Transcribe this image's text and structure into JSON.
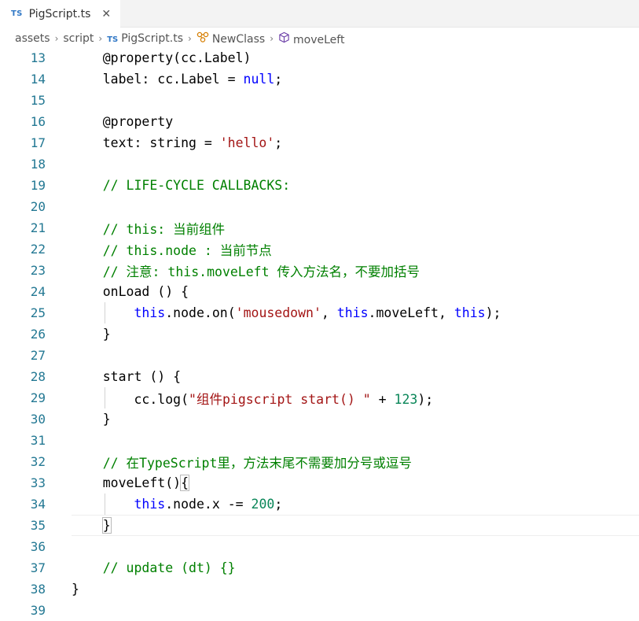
{
  "tab": {
    "badge": "TS",
    "filename": "PigScript.ts",
    "close_glyph": "✕"
  },
  "breadcrumb": {
    "items": [
      "assets",
      "script",
      "PigScript.ts",
      "NewClass",
      "moveLeft"
    ],
    "separator": "›",
    "file_badge": "TS"
  },
  "editor": {
    "active_line": 35,
    "lines": [
      {
        "n": "13",
        "tokens": [
          {
            "t": "    @property(cc.Label)",
            "c": "dec"
          }
        ]
      },
      {
        "n": "14",
        "tokens": [
          {
            "t": "    label: cc.Label = ",
            "c": ""
          },
          {
            "t": "null",
            "c": "kw"
          },
          {
            "t": ";",
            "c": ""
          }
        ]
      },
      {
        "n": "15",
        "tokens": []
      },
      {
        "n": "16",
        "tokens": [
          {
            "t": "    @property",
            "c": "dec"
          }
        ]
      },
      {
        "n": "17",
        "tokens": [
          {
            "t": "    text: string = ",
            "c": ""
          },
          {
            "t": "'hello'",
            "c": "str"
          },
          {
            "t": ";",
            "c": ""
          }
        ]
      },
      {
        "n": "18",
        "tokens": []
      },
      {
        "n": "19",
        "tokens": [
          {
            "t": "    // LIFE-CYCLE CALLBACKS:",
            "c": "cmt"
          }
        ]
      },
      {
        "n": "20",
        "tokens": []
      },
      {
        "n": "21",
        "tokens": [
          {
            "t": "    // this: 当前组件",
            "c": "cmt"
          }
        ]
      },
      {
        "n": "22",
        "tokens": [
          {
            "t": "    // this.node : 当前节点",
            "c": "cmt"
          }
        ]
      },
      {
        "n": "23",
        "tokens": [
          {
            "t": "    // 注意: this.moveLeft 传入方法名，不要加括号",
            "c": "cmt"
          }
        ]
      },
      {
        "n": "24",
        "tokens": [
          {
            "t": "    onLoad () {",
            "c": ""
          }
        ]
      },
      {
        "n": "25",
        "tokens": [
          {
            "t": "        ",
            "c": ""
          },
          {
            "t": "this",
            "c": "kw"
          },
          {
            "t": ".node.on(",
            "c": ""
          },
          {
            "t": "'mousedown'",
            "c": "str"
          },
          {
            "t": ", ",
            "c": ""
          },
          {
            "t": "this",
            "c": "kw"
          },
          {
            "t": ".moveLeft, ",
            "c": ""
          },
          {
            "t": "this",
            "c": "kw"
          },
          {
            "t": ");",
            "c": ""
          }
        ]
      },
      {
        "n": "26",
        "tokens": [
          {
            "t": "    }",
            "c": ""
          }
        ]
      },
      {
        "n": "27",
        "tokens": []
      },
      {
        "n": "28",
        "tokens": [
          {
            "t": "    start () {",
            "c": ""
          }
        ]
      },
      {
        "n": "29",
        "tokens": [
          {
            "t": "        cc.log(",
            "c": ""
          },
          {
            "t": "\"组件pigscript start() \"",
            "c": "str"
          },
          {
            "t": " + ",
            "c": ""
          },
          {
            "t": "123",
            "c": "num"
          },
          {
            "t": ");",
            "c": ""
          }
        ]
      },
      {
        "n": "30",
        "tokens": [
          {
            "t": "    }",
            "c": ""
          }
        ]
      },
      {
        "n": "31",
        "tokens": []
      },
      {
        "n": "32",
        "tokens": [
          {
            "t": "    // 在TypeScript里，方法末尾不需要加分号或逗号",
            "c": "cmt"
          }
        ]
      },
      {
        "n": "33",
        "tokens": [
          {
            "t": "    moveLeft()",
            "c": ""
          },
          {
            "t": "{",
            "c": "",
            "box": true
          }
        ]
      },
      {
        "n": "34",
        "tokens": [
          {
            "t": "        ",
            "c": ""
          },
          {
            "t": "this",
            "c": "kw"
          },
          {
            "t": ".node.x -= ",
            "c": ""
          },
          {
            "t": "200",
            "c": "num"
          },
          {
            "t": ";",
            "c": ""
          }
        ]
      },
      {
        "n": "35",
        "tokens": [
          {
            "t": "    ",
            "c": ""
          },
          {
            "t": "}",
            "c": "",
            "box": true
          }
        ]
      },
      {
        "n": "36",
        "tokens": []
      },
      {
        "n": "37",
        "tokens": [
          {
            "t": "    // update (dt) {}",
            "c": "cmt"
          }
        ]
      },
      {
        "n": "38",
        "tokens": [
          {
            "t": "}",
            "c": ""
          }
        ]
      },
      {
        "n": "39",
        "tokens": []
      }
    ]
  },
  "colors": {
    "keyword": "#0000ff",
    "string": "#a31515",
    "number": "#098658",
    "comment": "#008000",
    "line_number": "#237893",
    "ts_badge": "#3178c6"
  }
}
